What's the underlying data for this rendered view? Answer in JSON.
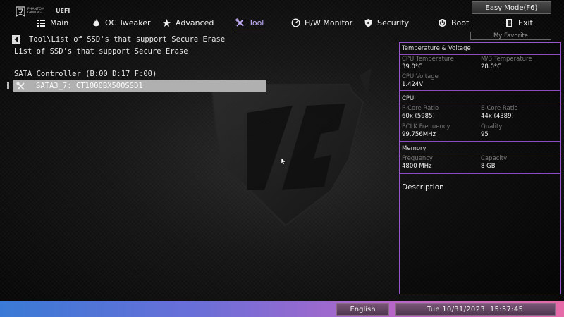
{
  "app": {
    "logo_brand": "PHANTOM GAMING",
    "logo_uefi": "UEFI"
  },
  "header": {
    "easy_mode": "Easy Mode(F6)",
    "tabs": [
      {
        "label": "Main",
        "icon": "list-icon"
      },
      {
        "label": "OC Tweaker",
        "icon": "flame-icon"
      },
      {
        "label": "Advanced",
        "icon": "star-icon"
      },
      {
        "label": "Tool",
        "icon": "tools-icon",
        "active": true
      },
      {
        "label": "H/W Monitor",
        "icon": "gauge-icon"
      },
      {
        "label": "Security",
        "icon": "shield-icon"
      },
      {
        "label": "Boot",
        "icon": "power-icon"
      },
      {
        "label": "Exit",
        "icon": "exit-door-icon"
      }
    ]
  },
  "main": {
    "breadcrumb": "Tool\\List of SSD's that support Secure Erase",
    "subtitle": "List of SSD's that support Secure Erase",
    "controller": "SATA Controller (B:00 D:17 F:00)",
    "ssd_items": [
      {
        "label": "SATA3_7:  CT1000BX500SSD1",
        "icon": "tools-icon",
        "selected": true
      }
    ]
  },
  "right_panel": {
    "my_favorite": "My Favorite",
    "temp_voltage": {
      "title": "Temperature & Voltage",
      "cpu_temp_label": "CPU Temperature",
      "cpu_temp_value": "39.0°C",
      "mb_temp_label": "M/B Temperature",
      "mb_temp_value": "28.0°C",
      "cpu_voltage_label": "CPU Voltage",
      "cpu_voltage_value": "1.424V"
    },
    "cpu": {
      "title": "CPU",
      "pcore_label": "P-Core Ratio",
      "pcore_value": "60x (5985)",
      "ecore_label": "E-Core Ratio",
      "ecore_value": "44x (4389)",
      "bclk_label": "BCLK Frequency",
      "bclk_value": "99.756MHz",
      "quality_label": "Quality",
      "quality_value": "95"
    },
    "memory": {
      "title": "Memory",
      "freq_label": "Frequency",
      "freq_value": "4800 MHz",
      "cap_label": "Capacity",
      "cap_value": "8 GB"
    },
    "description_title": "Description"
  },
  "footer": {
    "language": "English",
    "datetime": "Tue 10/31/2023. 15:57:45"
  },
  "colors": {
    "accent": "#a98bff",
    "panel_border": "#9a56c8",
    "selected_row": "#b0b0b0"
  }
}
